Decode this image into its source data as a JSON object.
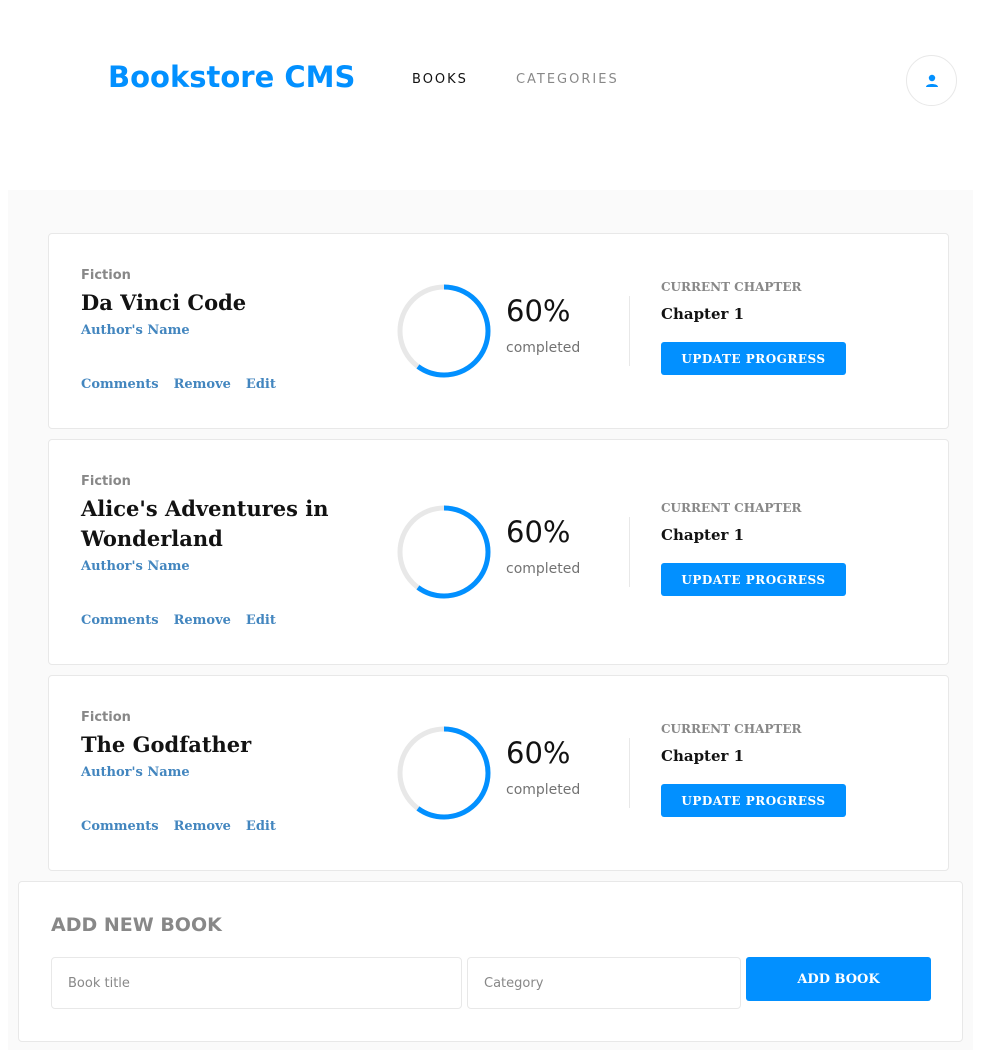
{
  "header": {
    "logo": "Bookstore CMS",
    "nav": [
      {
        "label": "BOOKS",
        "active": true
      },
      {
        "label": "CATEGORIES",
        "active": false
      }
    ],
    "user_icon": "user-icon"
  },
  "books": [
    {
      "genre": "Fiction",
      "title": "Da Vinci Code",
      "author": "Author's Name",
      "actions": [
        "Comments",
        "Remove",
        "Edit"
      ],
      "progress": 60,
      "progress_label": "60%",
      "completed_label": "completed",
      "current_chapter_label": "CURRENT CHAPTER",
      "current_chapter": "Chapter 1",
      "update_label": "UPDATE PROGRESS"
    },
    {
      "genre": "Fiction",
      "title": "Alice's Adventures in Wonderland",
      "author": "Author's Name",
      "actions": [
        "Comments",
        "Remove",
        "Edit"
      ],
      "progress": 60,
      "progress_label": "60%",
      "completed_label": "completed",
      "current_chapter_label": "CURRENT CHAPTER",
      "current_chapter": "Chapter 1",
      "update_label": "UPDATE PROGRESS"
    },
    {
      "genre": "Fiction",
      "title": "The Godfather",
      "author": "Author's Name",
      "actions": [
        "Comments",
        "Remove",
        "Edit"
      ],
      "progress": 60,
      "progress_label": "60%",
      "completed_label": "completed",
      "current_chapter_label": "CURRENT CHAPTER",
      "current_chapter": "Chapter 1",
      "update_label": "UPDATE PROGRESS"
    }
  ],
  "add_book": {
    "heading": "ADD NEW BOOK",
    "title_placeholder": "Book title",
    "category_placeholder": "Category",
    "submit_label": "ADD BOOK"
  },
  "colors": {
    "accent": "#0290ff",
    "link": "#4386bf",
    "progress_track": "#e8e8e8",
    "muted": "#888888"
  }
}
